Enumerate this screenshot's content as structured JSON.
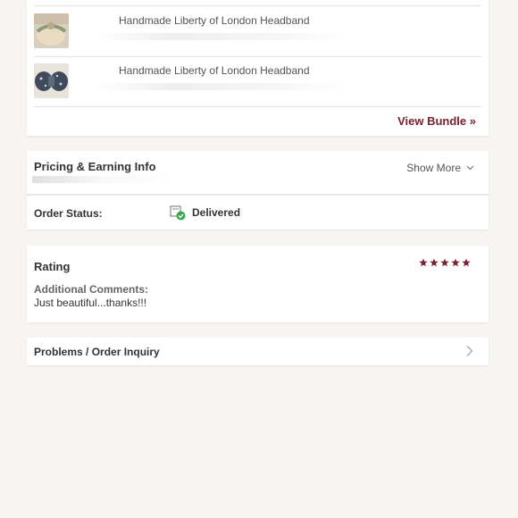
{
  "bundle": {
    "items": [
      {
        "title": "Handmade Liberty of London Headband",
        "thumb_icon": "headband-thumbnail"
      },
      {
        "title": "Handmade Liberty of London Headband",
        "thumb_icon": "headband-thumbnail"
      }
    ],
    "view_bundle_label": "View Bundle »"
  },
  "pricing": {
    "title": "Pricing & Earning Info",
    "show_more_label": "Show More"
  },
  "order_status": {
    "label": "Order Status:",
    "value": "Delivered",
    "status_icon": "delivered-box-check-icon",
    "status_color": "#3aa655"
  },
  "rating": {
    "title": "Rating",
    "stars": 5,
    "star_color": "#7a2130",
    "comments_label": "Additional Comments:",
    "comments": "Just beautiful...thanks!!!"
  },
  "problems": {
    "label": "Problems / Order Inquiry"
  },
  "colors": {
    "accent": "#7a2130",
    "background": "#f6f5f2"
  }
}
